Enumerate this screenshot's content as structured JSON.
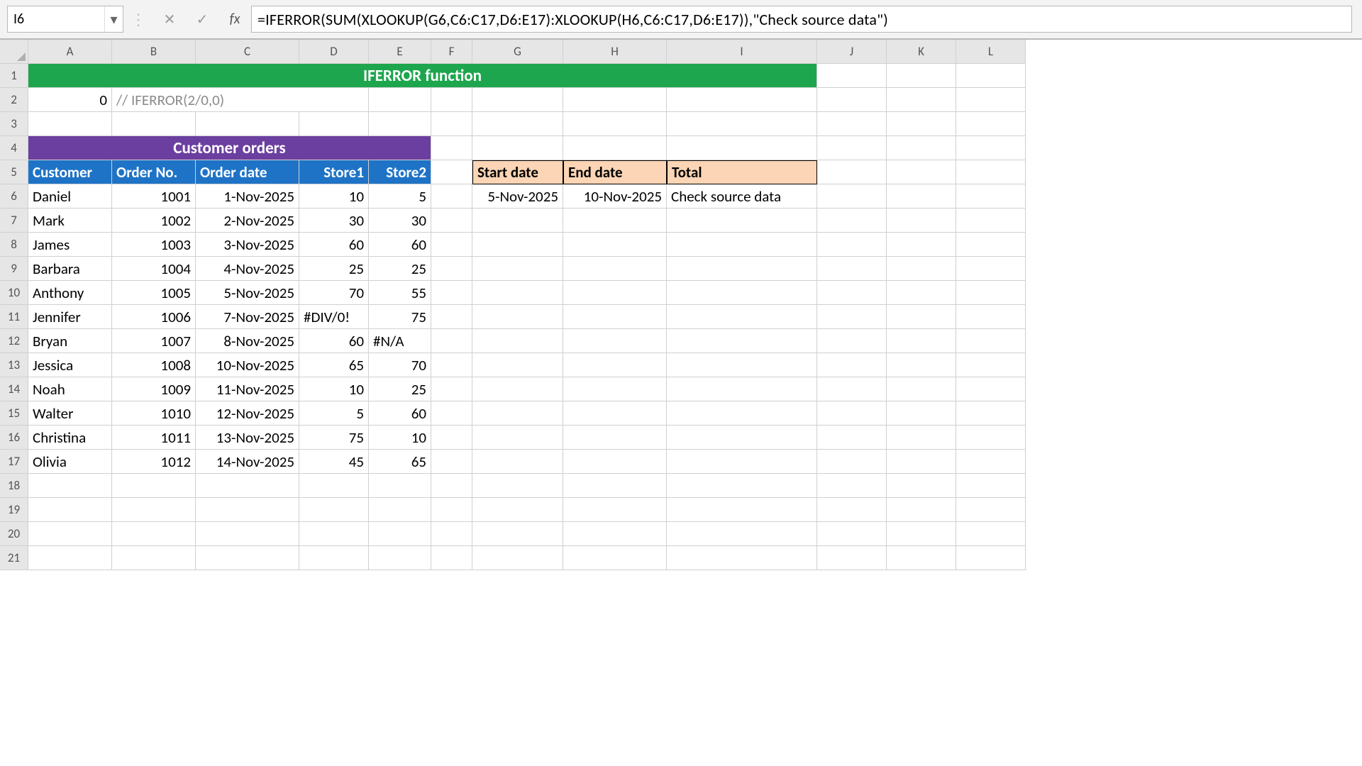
{
  "formula_bar": {
    "cell_ref": "I6",
    "formula": "=IFERROR(SUM(XLOOKUP(G6,C6:C17,D6:E17):XLOOKUP(H6,C6:C17,D6:E17)),\"Check source data\")",
    "fx_label": "fx",
    "cancel_glyph": "✕",
    "confirm_glyph": "✓",
    "dropdown_glyph": "▾",
    "sep_glyph": "⋮"
  },
  "columns": [
    "A",
    "B",
    "C",
    "D",
    "E",
    "F",
    "G",
    "H",
    "I",
    "J",
    "K",
    "L"
  ],
  "row_numbers": [
    1,
    2,
    3,
    4,
    5,
    6,
    7,
    8,
    9,
    10,
    11,
    12,
    13,
    14,
    15,
    16,
    17,
    18,
    19,
    20,
    21
  ],
  "r1": {
    "title": "IFERROR function"
  },
  "r2": {
    "A": "0",
    "B": "// IFERROR(2/0,0)"
  },
  "r4": {
    "title": "Customer orders"
  },
  "r5": {
    "A": "Customer",
    "B": "Order No.",
    "C": "Order date",
    "D": "Store1",
    "E": "Store2",
    "G": "Start date",
    "H": "End date",
    "I": "Total"
  },
  "orders": [
    {
      "A": "Daniel",
      "B": "1001",
      "C": "1-Nov-2025",
      "D": "10",
      "E": "5"
    },
    {
      "A": "Mark",
      "B": "1002",
      "C": "2-Nov-2025",
      "D": "30",
      "E": "30"
    },
    {
      "A": "James",
      "B": "1003",
      "C": "3-Nov-2025",
      "D": "60",
      "E": "60"
    },
    {
      "A": "Barbara",
      "B": "1004",
      "C": "4-Nov-2025",
      "D": "25",
      "E": "25"
    },
    {
      "A": "Anthony",
      "B": "1005",
      "C": "5-Nov-2025",
      "D": "70",
      "E": "55"
    },
    {
      "A": "Jennifer",
      "B": "1006",
      "C": "7-Nov-2025",
      "D": "#DIV/0!",
      "E": "75"
    },
    {
      "A": "Bryan",
      "B": "1007",
      "C": "8-Nov-2025",
      "D": "60",
      "E": "#N/A"
    },
    {
      "A": "Jessica",
      "B": "1008",
      "C": "10-Nov-2025",
      "D": "65",
      "E": "70"
    },
    {
      "A": "Noah",
      "B": "1009",
      "C": "11-Nov-2025",
      "D": "10",
      "E": "25"
    },
    {
      "A": "Walter",
      "B": "1010",
      "C": "12-Nov-2025",
      "D": "5",
      "E": "60"
    },
    {
      "A": "Christina",
      "B": "1011",
      "C": "13-Nov-2025",
      "D": "75",
      "E": "10"
    },
    {
      "A": "Olivia",
      "B": "1012",
      "C": "14-Nov-2025",
      "D": "45",
      "E": "65"
    }
  ],
  "r6_right": {
    "G": "5-Nov-2025",
    "H": "10-Nov-2025",
    "I": "Check source data"
  }
}
